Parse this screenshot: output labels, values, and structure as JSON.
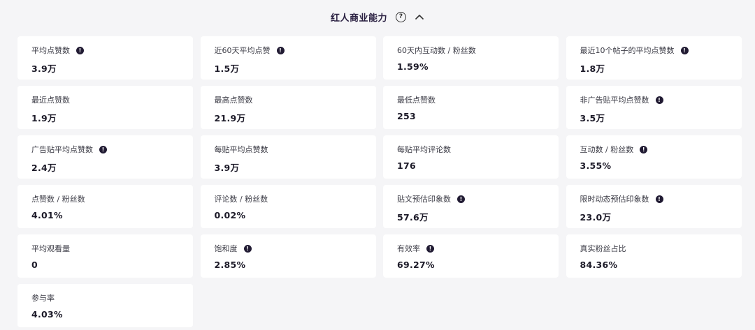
{
  "header": {
    "title": "红人商业能力",
    "help_glyph": "?"
  },
  "metrics": [
    {
      "label": "平均点赞数",
      "value": "3.9万",
      "info": true
    },
    {
      "label": "近60天平均点赞",
      "value": "1.5万",
      "info": true
    },
    {
      "label": "60天内互动数 / 粉丝数",
      "value": "1.59%",
      "info": false
    },
    {
      "label": "最近10个帖子的平均点赞数",
      "value": "1.8万",
      "info": true
    },
    {
      "label": "最近点赞数",
      "value": "1.9万",
      "info": false
    },
    {
      "label": "最高点赞数",
      "value": "21.9万",
      "info": false
    },
    {
      "label": "最低点赞数",
      "value": "253",
      "info": false
    },
    {
      "label": "非广告贴平均点赞数",
      "value": "3.5万",
      "info": true
    },
    {
      "label": "广告贴平均点赞数",
      "value": "2.4万",
      "info": true
    },
    {
      "label": "每贴平均点赞数",
      "value": "3.9万",
      "info": false
    },
    {
      "label": "每贴平均评论数",
      "value": "176",
      "info": false
    },
    {
      "label": "互动数 / 粉丝数",
      "value": "3.55%",
      "info": true
    },
    {
      "label": "点赞数 / 粉丝数",
      "value": "4.01%",
      "info": false
    },
    {
      "label": "评论数 / 粉丝数",
      "value": "0.02%",
      "info": false
    },
    {
      "label": "贴文预估印象数",
      "value": "57.6万",
      "info": true
    },
    {
      "label": "限时动态预估印象数",
      "value": "23.0万",
      "info": true
    },
    {
      "label": "平均观看量",
      "value": "0",
      "info": false
    },
    {
      "label": "饱和度",
      "value": "2.85%",
      "info": true
    },
    {
      "label": "有效率",
      "value": "69.27%",
      "info": true
    },
    {
      "label": "真实粉丝占比",
      "value": "84.36%",
      "info": false
    },
    {
      "label": "参与率",
      "value": "4.03%",
      "info": false
    }
  ],
  "icons": {
    "info": "info-icon",
    "help": "help-icon",
    "collapse": "chevron-up-icon"
  },
  "colors": {
    "background": "#f5f5f7",
    "card": "#ffffff",
    "title": "#2b2142",
    "info_icon": "#211b33"
  }
}
